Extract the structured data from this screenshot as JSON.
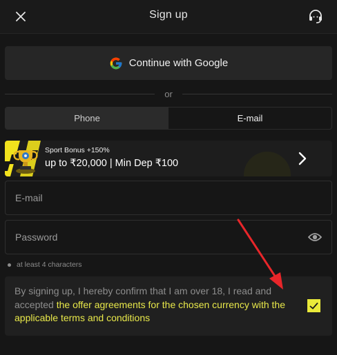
{
  "header": {
    "title": "Sign up",
    "close_icon": "close-icon",
    "support_icon": "headset-icon"
  },
  "google": {
    "label": "Continue with Google",
    "icon": "google-icon"
  },
  "divider": {
    "text": "or"
  },
  "tabs": [
    {
      "label": "Phone",
      "active": false
    },
    {
      "label": "E-mail",
      "active": true
    }
  ],
  "banner": {
    "small_text": "Sport Bonus +150%",
    "big_text": "up to ₹20,000 | Min Dep ₹100",
    "chevron_icon": "chevron-right-icon"
  },
  "form": {
    "email_placeholder": "E-mail",
    "email_value": "",
    "password_placeholder": "Password",
    "password_value": "",
    "eye_icon": "eye-icon",
    "password_hint": "at least 4 characters"
  },
  "terms": {
    "plain_text": "By signing up, I hereby confirm that I am over 18, I read and accepted ",
    "link_text": "the offer agreements for the chosen currency with the applicable terms and conditions",
    "checked": true
  },
  "colors": {
    "accent_yellow": "#eaea3a",
    "background": "#161616",
    "annotation_arrow": "#e8262a"
  }
}
